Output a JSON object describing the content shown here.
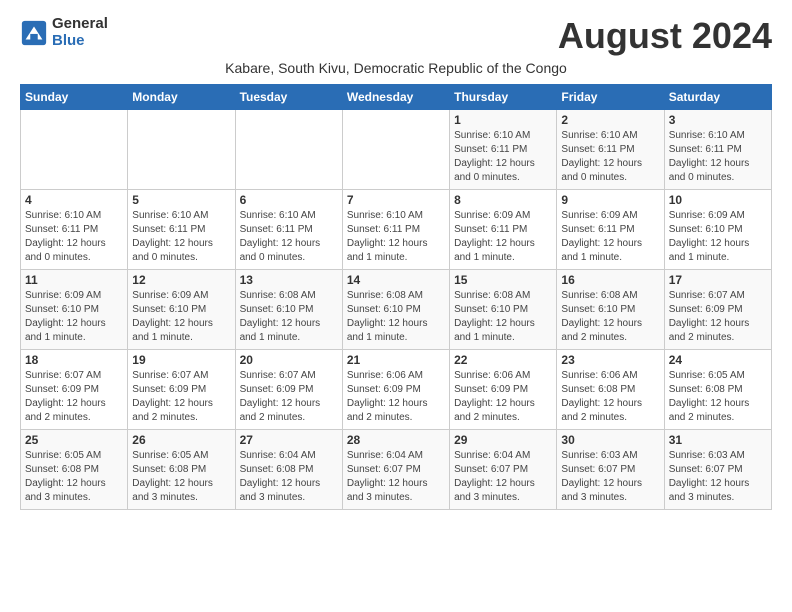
{
  "logo": {
    "general": "General",
    "blue": "Blue"
  },
  "title": "August 2024",
  "subtitle": "Kabare, South Kivu, Democratic Republic of the Congo",
  "days_of_week": [
    "Sunday",
    "Monday",
    "Tuesday",
    "Wednesday",
    "Thursday",
    "Friday",
    "Saturday"
  ],
  "weeks": [
    [
      {
        "day": "",
        "info": ""
      },
      {
        "day": "",
        "info": ""
      },
      {
        "day": "",
        "info": ""
      },
      {
        "day": "",
        "info": ""
      },
      {
        "day": "1",
        "info": "Sunrise: 6:10 AM\nSunset: 6:11 PM\nDaylight: 12 hours\nand 0 minutes."
      },
      {
        "day": "2",
        "info": "Sunrise: 6:10 AM\nSunset: 6:11 PM\nDaylight: 12 hours\nand 0 minutes."
      },
      {
        "day": "3",
        "info": "Sunrise: 6:10 AM\nSunset: 6:11 PM\nDaylight: 12 hours\nand 0 minutes."
      }
    ],
    [
      {
        "day": "4",
        "info": "Sunrise: 6:10 AM\nSunset: 6:11 PM\nDaylight: 12 hours\nand 0 minutes."
      },
      {
        "day": "5",
        "info": "Sunrise: 6:10 AM\nSunset: 6:11 PM\nDaylight: 12 hours\nand 0 minutes."
      },
      {
        "day": "6",
        "info": "Sunrise: 6:10 AM\nSunset: 6:11 PM\nDaylight: 12 hours\nand 0 minutes."
      },
      {
        "day": "7",
        "info": "Sunrise: 6:10 AM\nSunset: 6:11 PM\nDaylight: 12 hours\nand 1 minute."
      },
      {
        "day": "8",
        "info": "Sunrise: 6:09 AM\nSunset: 6:11 PM\nDaylight: 12 hours\nand 1 minute."
      },
      {
        "day": "9",
        "info": "Sunrise: 6:09 AM\nSunset: 6:11 PM\nDaylight: 12 hours\nand 1 minute."
      },
      {
        "day": "10",
        "info": "Sunrise: 6:09 AM\nSunset: 6:10 PM\nDaylight: 12 hours\nand 1 minute."
      }
    ],
    [
      {
        "day": "11",
        "info": "Sunrise: 6:09 AM\nSunset: 6:10 PM\nDaylight: 12 hours\nand 1 minute."
      },
      {
        "day": "12",
        "info": "Sunrise: 6:09 AM\nSunset: 6:10 PM\nDaylight: 12 hours\nand 1 minute."
      },
      {
        "day": "13",
        "info": "Sunrise: 6:08 AM\nSunset: 6:10 PM\nDaylight: 12 hours\nand 1 minute."
      },
      {
        "day": "14",
        "info": "Sunrise: 6:08 AM\nSunset: 6:10 PM\nDaylight: 12 hours\nand 1 minute."
      },
      {
        "day": "15",
        "info": "Sunrise: 6:08 AM\nSunset: 6:10 PM\nDaylight: 12 hours\nand 1 minute."
      },
      {
        "day": "16",
        "info": "Sunrise: 6:08 AM\nSunset: 6:10 PM\nDaylight: 12 hours\nand 2 minutes."
      },
      {
        "day": "17",
        "info": "Sunrise: 6:07 AM\nSunset: 6:09 PM\nDaylight: 12 hours\nand 2 minutes."
      }
    ],
    [
      {
        "day": "18",
        "info": "Sunrise: 6:07 AM\nSunset: 6:09 PM\nDaylight: 12 hours\nand 2 minutes."
      },
      {
        "day": "19",
        "info": "Sunrise: 6:07 AM\nSunset: 6:09 PM\nDaylight: 12 hours\nand 2 minutes."
      },
      {
        "day": "20",
        "info": "Sunrise: 6:07 AM\nSunset: 6:09 PM\nDaylight: 12 hours\nand 2 minutes."
      },
      {
        "day": "21",
        "info": "Sunrise: 6:06 AM\nSunset: 6:09 PM\nDaylight: 12 hours\nand 2 minutes."
      },
      {
        "day": "22",
        "info": "Sunrise: 6:06 AM\nSunset: 6:09 PM\nDaylight: 12 hours\nand 2 minutes."
      },
      {
        "day": "23",
        "info": "Sunrise: 6:06 AM\nSunset: 6:08 PM\nDaylight: 12 hours\nand 2 minutes."
      },
      {
        "day": "24",
        "info": "Sunrise: 6:05 AM\nSunset: 6:08 PM\nDaylight: 12 hours\nand 2 minutes."
      }
    ],
    [
      {
        "day": "25",
        "info": "Sunrise: 6:05 AM\nSunset: 6:08 PM\nDaylight: 12 hours\nand 3 minutes."
      },
      {
        "day": "26",
        "info": "Sunrise: 6:05 AM\nSunset: 6:08 PM\nDaylight: 12 hours\nand 3 minutes."
      },
      {
        "day": "27",
        "info": "Sunrise: 6:04 AM\nSunset: 6:08 PM\nDaylight: 12 hours\nand 3 minutes."
      },
      {
        "day": "28",
        "info": "Sunrise: 6:04 AM\nSunset: 6:07 PM\nDaylight: 12 hours\nand 3 minutes."
      },
      {
        "day": "29",
        "info": "Sunrise: 6:04 AM\nSunset: 6:07 PM\nDaylight: 12 hours\nand 3 minutes."
      },
      {
        "day": "30",
        "info": "Sunrise: 6:03 AM\nSunset: 6:07 PM\nDaylight: 12 hours\nand 3 minutes."
      },
      {
        "day": "31",
        "info": "Sunrise: 6:03 AM\nSunset: 6:07 PM\nDaylight: 12 hours\nand 3 minutes."
      }
    ]
  ]
}
